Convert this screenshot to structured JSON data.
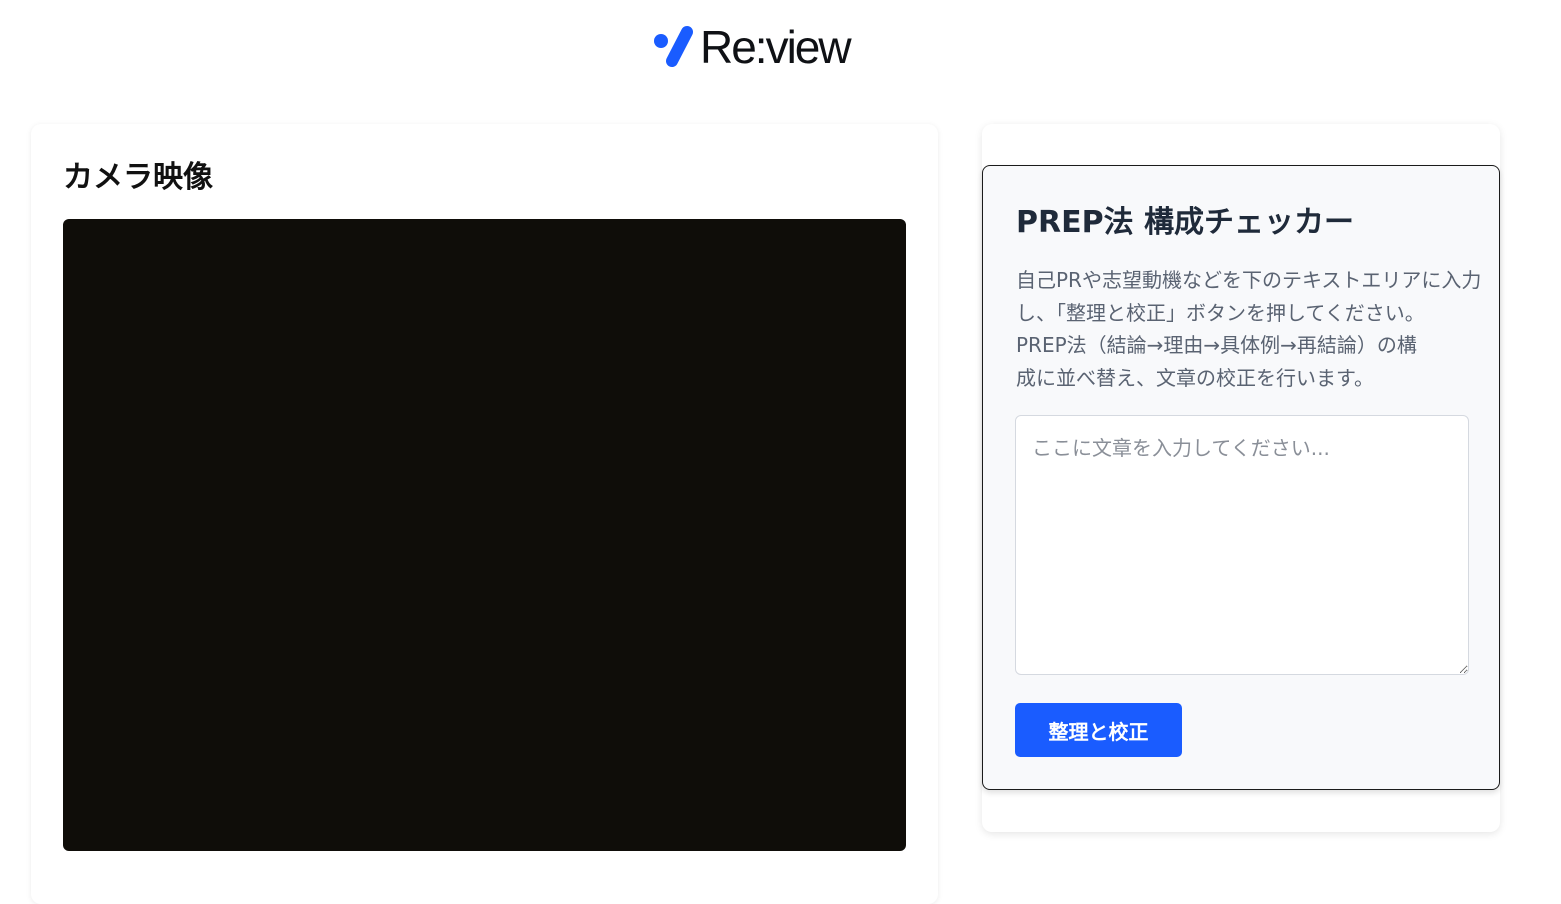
{
  "header": {
    "logo_text": "Re:view",
    "logo_icon": "check-mark-icon",
    "brand_color": "#1a5cff"
  },
  "camera": {
    "title": "カメラ映像"
  },
  "checker": {
    "title": "PREP法 構成チェッカー",
    "description_lines": [
      "自己PRや志望動機などを下のテキストエリアに入力",
      "し、「整理と校正」ボタンを押してください。",
      "PREP法（結論→理由→具体例→再結論）の構",
      "成に並べ替え、文章の校正を行います。"
    ],
    "textarea_value": "",
    "textarea_placeholder": "ここに文章を入力してください...",
    "button_label": "整理と校正"
  }
}
